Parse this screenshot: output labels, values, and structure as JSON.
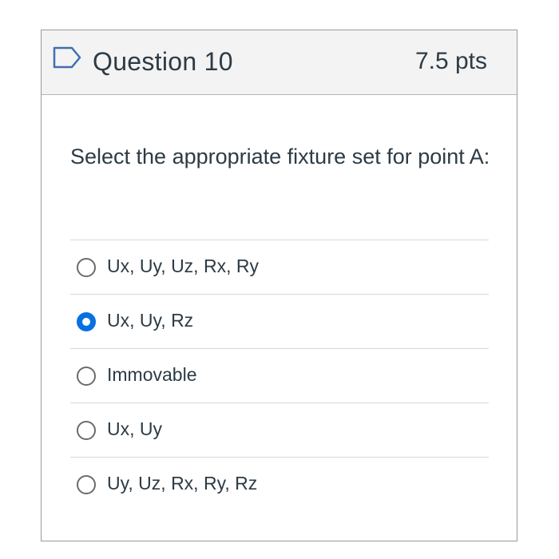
{
  "question": {
    "title": "Question 10",
    "points": "7.5 pts",
    "flag_icon": "bookmark-flag-icon",
    "text": "Select the appropriate fixture set for point A:"
  },
  "answers": [
    {
      "label": "Ux, Uy, Uz, Rx, Ry",
      "selected": false
    },
    {
      "label": "Ux, Uy, Rz",
      "selected": true
    },
    {
      "label": "Immovable",
      "selected": false
    },
    {
      "label": "Ux, Uy",
      "selected": false
    },
    {
      "label": "Uy, Uz, Rx, Ry, Rz",
      "selected": false
    }
  ],
  "colors": {
    "accent": "#0770e3",
    "text": "#2d3b45",
    "header_bg": "#f3f3f3",
    "border": "#9a9a9a"
  }
}
